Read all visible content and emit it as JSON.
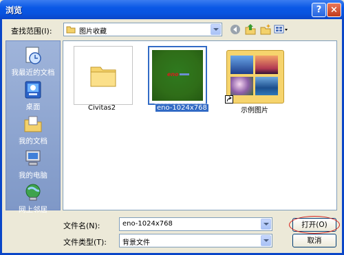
{
  "window": {
    "title": "浏览"
  },
  "titlebar": {
    "help_label": "?",
    "close_label": "×"
  },
  "look_in": {
    "label": "查找范围(I):",
    "value": "图片收藏"
  },
  "places": [
    {
      "label": "我最近的文档",
      "icon": "recent-documents-icon"
    },
    {
      "label": "桌面",
      "icon": "desktop-icon"
    },
    {
      "label": "我的文档",
      "icon": "my-documents-icon"
    },
    {
      "label": "我的电脑",
      "icon": "my-computer-icon"
    },
    {
      "label": "网上邻居",
      "icon": "network-places-icon"
    }
  ],
  "files": [
    {
      "name": "Civitas2",
      "type": "folder"
    },
    {
      "name": "eno-1024x768",
      "type": "image",
      "selected": true,
      "thumb_text": "eno"
    },
    {
      "name": "示例图片",
      "type": "folder-shortcut"
    }
  ],
  "filename": {
    "label": "文件名(N):",
    "value": "eno-1024x768"
  },
  "filetype": {
    "label": "文件类型(T):",
    "value": "背景文件"
  },
  "buttons": {
    "open": "打开(O)",
    "cancel": "取消"
  },
  "colors": {
    "titlebar": "#0a58e6",
    "selection": "#316ac5",
    "highlight_ring": "#d9211b"
  }
}
